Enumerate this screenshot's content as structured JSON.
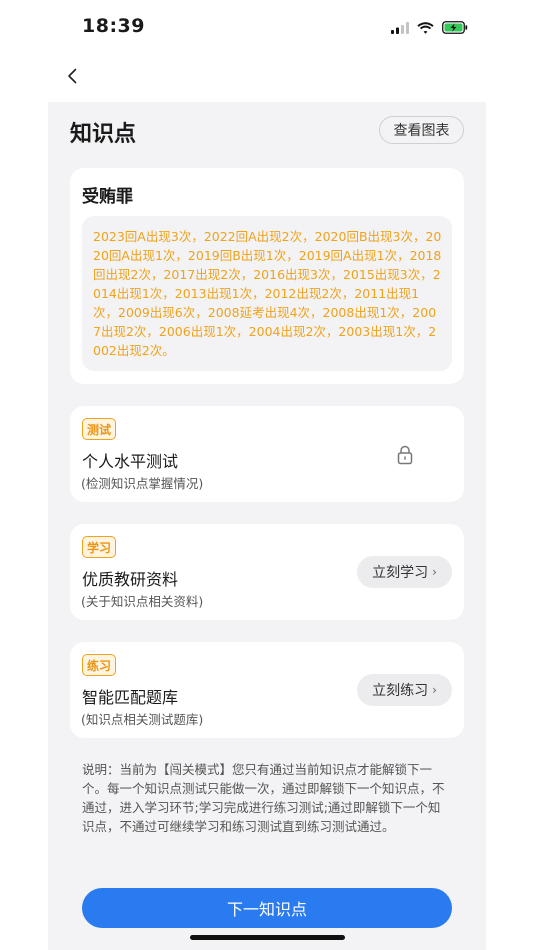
{
  "status_bar": {
    "time": "18:39"
  },
  "header": {
    "title": "知识点",
    "chart_button": "查看图表"
  },
  "topic": {
    "name": "受贿罪",
    "history": "2023回A出现3次，2022回A出现2次，2020回B出现3次，2020回A出现1次，2019回B出现1次，2019回A出现1次，2018回出现2次，2017出现2次，2016出现3次，2015出现3次，2014出现1次，2013出现1次，2012出现2次，2011出现1次，2009出现6次，2008延考出现4次，2008出现1次，2007出现2次，2006出现1次，2004出现2次，2003出现1次，2002出现2次。"
  },
  "steps": {
    "test": {
      "badge": "测试",
      "title": "个人水平测试",
      "subtitle": "(检测知识点掌握情况)",
      "icon": "lock-icon"
    },
    "study": {
      "badge": "学习",
      "title": "优质教研资料",
      "subtitle": "(关于知识点相关资料)",
      "button": "立刻学习"
    },
    "practice": {
      "badge": "练习",
      "title": "智能匹配题库",
      "subtitle": "(知识点相关测试题库)",
      "button": "立刻练习"
    }
  },
  "note": "说明：当前为【闯关模式】您只有通过当前知识点才能解锁下一个。每一个知识点测试只能做一次，通过即解锁下一个知识点，不通过，进入学习环节;学习完成进行练习测试;通过即解锁下一个知识点，不通过可继续学习和练习测试直到练习测试通过。",
  "footer": {
    "next_button": "下一知识点"
  },
  "colors": {
    "accent": "#f0a21a",
    "primary": "#2b7bf0",
    "panel_bg": "#f3f3f5",
    "battery": "#34c759"
  }
}
